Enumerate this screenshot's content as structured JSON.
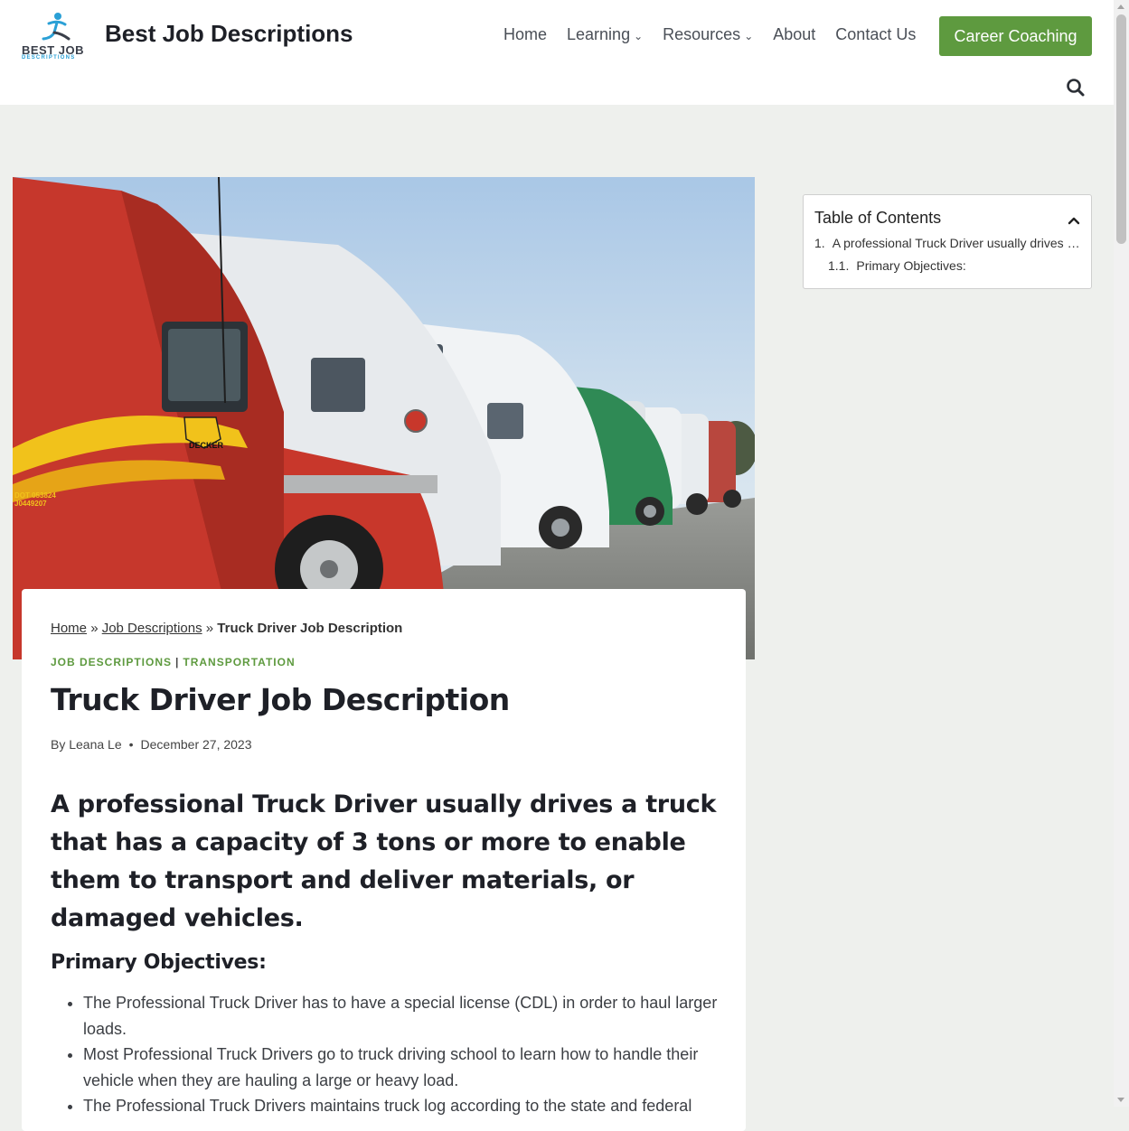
{
  "header": {
    "logo_line1": "BEST JOB",
    "logo_line2": "DESCRIPTIONS",
    "site_title": "Best Job Descriptions",
    "nav": {
      "home": "Home",
      "learning": "Learning",
      "resources": "Resources",
      "about": "About",
      "contact": "Contact Us"
    },
    "cta": "Career Coaching"
  },
  "hero": {
    "decal_brand": "DECKER",
    "decal_dot": "DOT 053824",
    "decal_num": "J0449207"
  },
  "article": {
    "breadcrumb": {
      "home": "Home",
      "sep1": "»",
      "section": "Job Descriptions",
      "sep2": "»",
      "current": "Truck Driver Job Description"
    },
    "categories": {
      "cat1": "JOB DESCRIPTIONS",
      "sep": "|",
      "cat2": "TRANSPORTATION"
    },
    "title": "Truck Driver Job Description",
    "meta": {
      "author": "By Leana Le",
      "dot": "•",
      "date": "December 27, 2023"
    },
    "lead": "A professional Truck Driver usually drives a truck that has a capacity of 3 tons or more to enable them to transport and deliver materials, or damaged vehicles.",
    "section_heading": "Primary Objectives:",
    "bullets": [
      "The Professional Truck Driver has to have a special license (CDL) in order to haul larger loads.",
      "Most Professional Truck Drivers go to truck driving school to learn how to handle their vehicle when they are hauling a large or heavy load.",
      "The Professional Truck Drivers maintains truck log according to the state and federal"
    ]
  },
  "toc": {
    "title": "Table of Contents",
    "item1_num": "1.",
    "item1": "A professional Truck Driver usually drives …",
    "item2_num": "1.1.",
    "item2": "Primary Objectives:"
  },
  "colors": {
    "accent_green": "#5e9a3f",
    "page_bg": "#eef0ed",
    "logo_blue": "#2aa0d6"
  },
  "icons": {
    "search": "search-icon",
    "toc_toggle": "chevron-up-icon",
    "nav_dropdown": "chevron-down-icon"
  }
}
